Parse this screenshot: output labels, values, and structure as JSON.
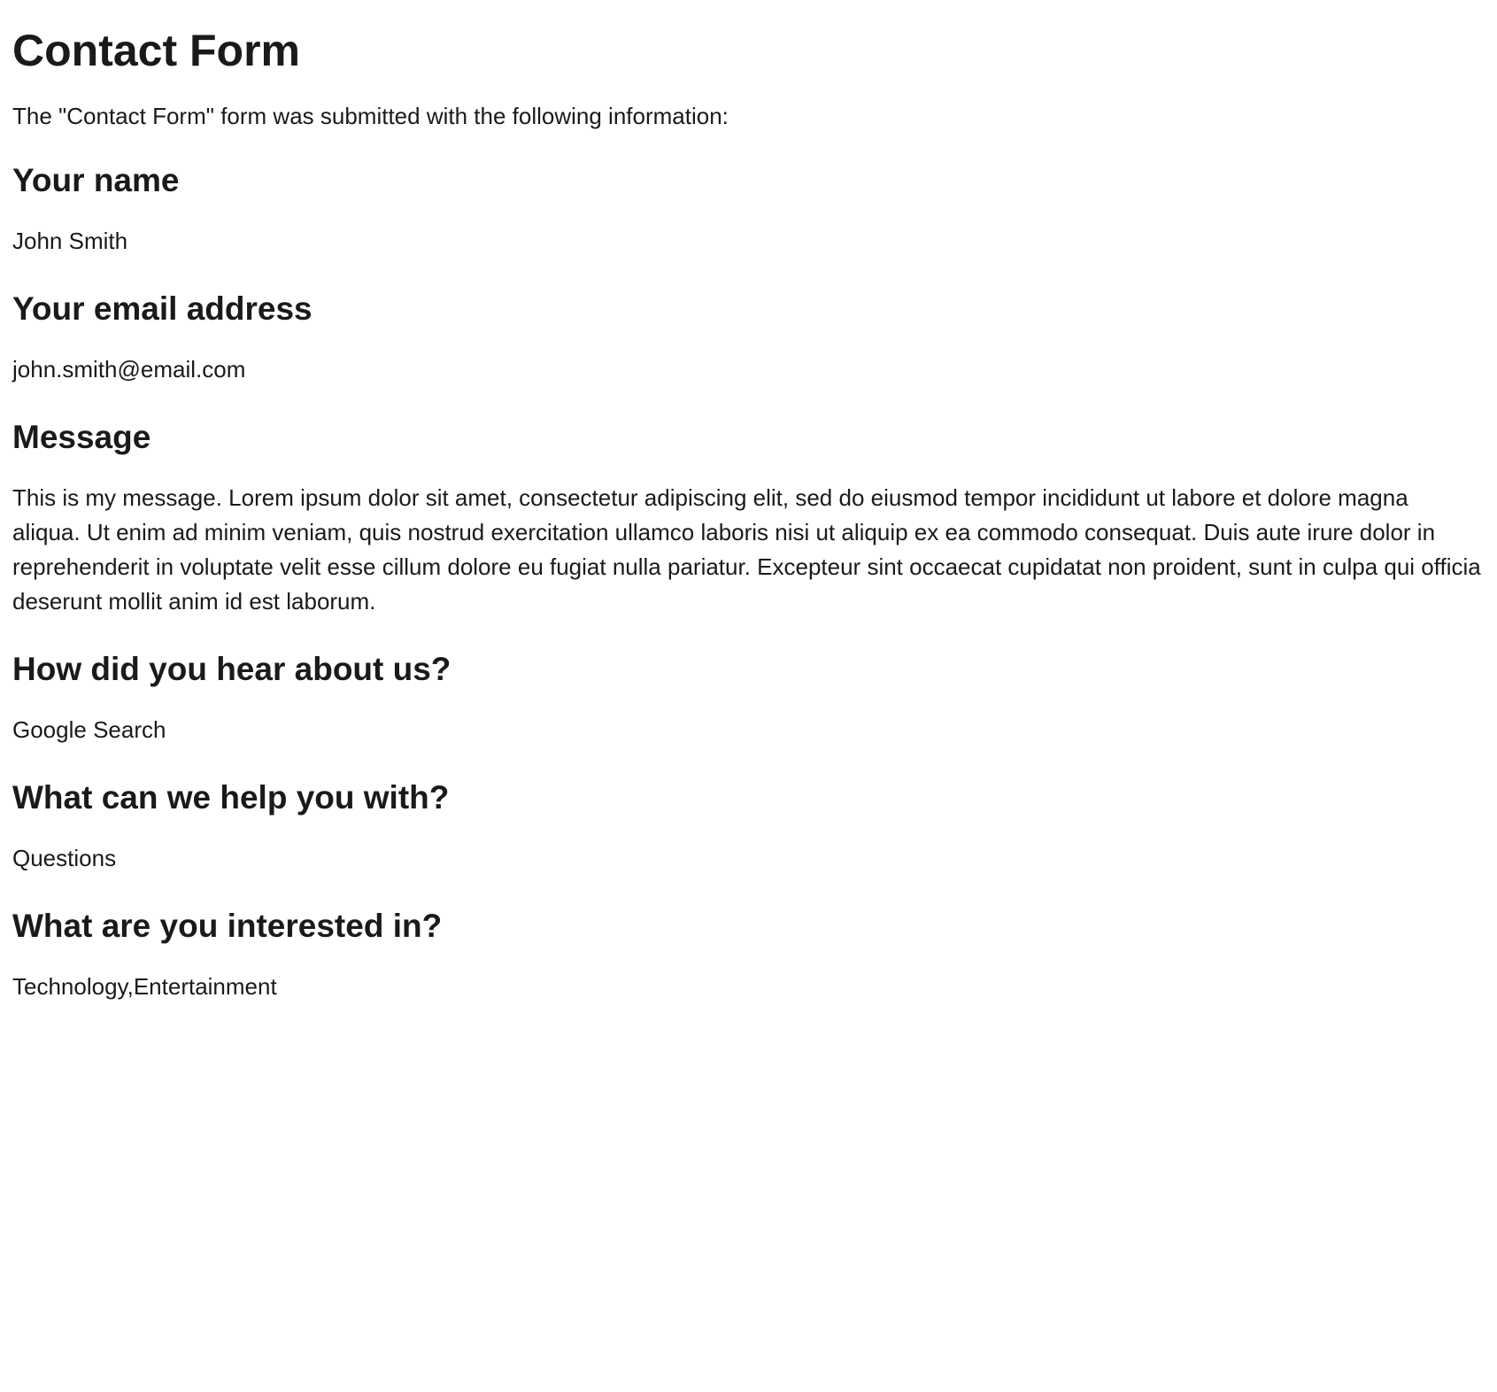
{
  "title": "Contact Form",
  "intro": "The \"Contact Form\" form was submitted with the following information:",
  "fields": {
    "name": {
      "label": "Your name",
      "value": "John Smith"
    },
    "email": {
      "label": "Your email address",
      "value": "john.smith@email.com"
    },
    "message": {
      "label": "Message",
      "value": "This is my message. Lorem ipsum dolor sit amet, consectetur adipiscing elit, sed do eiusmod tempor incididunt ut labore et dolore magna aliqua. Ut enim ad minim veniam, quis nostrud exercitation ullamco laboris nisi ut aliquip ex ea commodo consequat. Duis aute irure dolor in reprehenderit in voluptate velit esse cillum dolore eu fugiat nulla pariatur. Excepteur sint occaecat cupidatat non proident, sunt in culpa qui officia deserunt mollit anim id est laborum."
    },
    "hear_about": {
      "label": "How did you hear about us?",
      "value": "Google Search"
    },
    "help_with": {
      "label": "What can we help you with?",
      "value": "Questions"
    },
    "interested_in": {
      "label": "What are you interested in?",
      "value": "Technology,Entertainment"
    }
  }
}
